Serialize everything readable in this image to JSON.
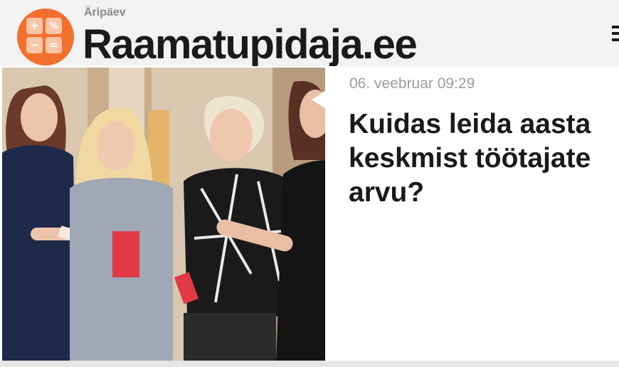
{
  "header": {
    "publisher": "Äripäev",
    "site_title": "Raamatupidaja.ee",
    "logo_keys": [
      "+",
      "%",
      "−",
      "="
    ],
    "logo_color": "#f36f2e",
    "menu_icon": "hamburger-menu-icon"
  },
  "article": {
    "date": "06. veebruar 09:29",
    "title": "Kuidas leida aasta keskmist töötajate arvu?",
    "image": "photo-four-women-talking"
  }
}
